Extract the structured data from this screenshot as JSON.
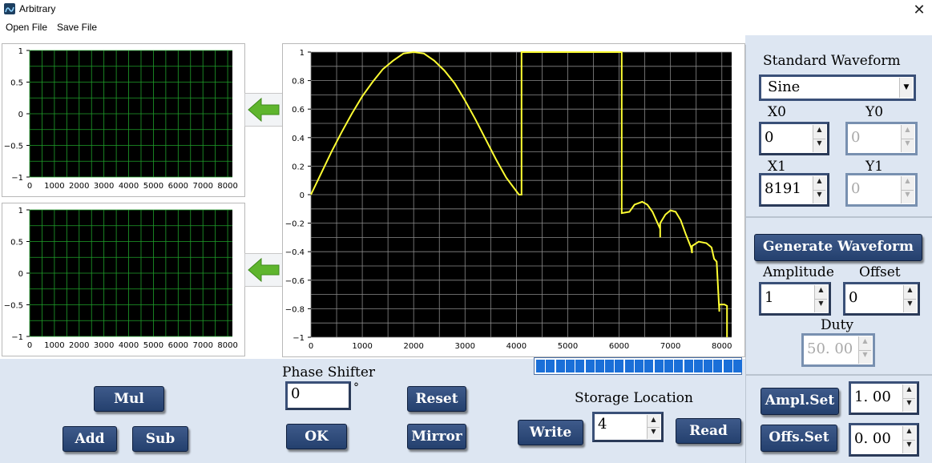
{
  "window": {
    "title": "Arbitrary",
    "close_glyph": "✕"
  },
  "menu": {
    "items": [
      "Open File",
      "Save File"
    ]
  },
  "small_chart_1": {
    "chart_data": {
      "type": "line",
      "xlim": [
        0,
        8191
      ],
      "ylim": [
        -1,
        1
      ],
      "xticks": [
        "0",
        "1000",
        "2000",
        "3000",
        "4000",
        "5000",
        "6000",
        "7000",
        "8000"
      ],
      "yticks": [
        "1",
        "0.5",
        "0",
        "−0.5",
        "−1"
      ],
      "series": [],
      "grid": true
    }
  },
  "small_chart_2": {
    "chart_data": {
      "type": "line",
      "xlim": [
        0,
        8191
      ],
      "ylim": [
        -1,
        1
      ],
      "xticks": [
        "0",
        "1000",
        "2000",
        "3000",
        "4000",
        "5000",
        "6000",
        "7000",
        "8000"
      ],
      "yticks": [
        "1",
        "0.5",
        "0",
        "−0.5",
        "−1"
      ],
      "series": [],
      "grid": true
    }
  },
  "main_chart": {
    "chart_data": {
      "type": "line",
      "xlim": [
        0,
        8191
      ],
      "ylim": [
        -1,
        1
      ],
      "xticks": [
        "0",
        "1000",
        "2000",
        "3000",
        "4000",
        "5000",
        "6000",
        "7000",
        "8000"
      ],
      "yticks": [
        "1",
        "0.8",
        "0.6",
        "0.4",
        "0.2",
        "0",
        "−0.2",
        "−0.4",
        "−0.6",
        "−0.8",
        "−1"
      ],
      "grid": true,
      "series": [
        {
          "color": "#ffff33",
          "points": [
            [
              0,
              0
            ],
            [
              200,
              0.15
            ],
            [
              400,
              0.3
            ],
            [
              600,
              0.44
            ],
            [
              800,
              0.57
            ],
            [
              1000,
              0.69
            ],
            [
              1200,
              0.79
            ],
            [
              1400,
              0.88
            ],
            [
              1600,
              0.94
            ],
            [
              1800,
              0.99
            ],
            [
              2000,
              1.0
            ],
            [
              2200,
              0.99
            ],
            [
              2400,
              0.94
            ],
            [
              2600,
              0.87
            ],
            [
              2800,
              0.78
            ],
            [
              3000,
              0.66
            ],
            [
              3200,
              0.53
            ],
            [
              3400,
              0.39
            ],
            [
              3600,
              0.25
            ],
            [
              3800,
              0.12
            ],
            [
              4050,
              0.0
            ],
            [
              4100,
              0.0
            ],
            [
              4100,
              1.0
            ],
            [
              6050,
              1.0
            ],
            [
              6050,
              -0.13
            ],
            [
              6200,
              -0.12
            ],
            [
              6300,
              -0.07
            ],
            [
              6450,
              -0.05
            ],
            [
              6550,
              -0.07
            ],
            [
              6650,
              -0.12
            ],
            [
              6700,
              -0.16
            ],
            [
              6750,
              -0.2
            ],
            [
              6800,
              -0.24
            ],
            [
              6800,
              -0.3
            ],
            [
              6800,
              -0.2
            ],
            [
              6900,
              -0.14
            ],
            [
              7000,
              -0.11
            ],
            [
              7100,
              -0.12
            ],
            [
              7200,
              -0.18
            ],
            [
              7300,
              -0.28
            ],
            [
              7400,
              -0.37
            ],
            [
              7420,
              -0.41
            ],
            [
              7420,
              -0.36
            ],
            [
              7550,
              -0.33
            ],
            [
              7700,
              -0.34
            ],
            [
              7800,
              -0.37
            ],
            [
              7850,
              -0.45
            ],
            [
              7900,
              -0.47
            ],
            [
              7950,
              -0.82
            ],
            [
              7950,
              -0.77
            ],
            [
              8050,
              -0.77
            ],
            [
              8100,
              -0.78
            ],
            [
              8100,
              -1.0
            ]
          ]
        }
      ]
    }
  },
  "phase_shifter": {
    "label": "Phase Shifter",
    "value": "0",
    "unit": "°",
    "ok_label": "OK"
  },
  "buttons": {
    "mul": "Mul",
    "add": "Add",
    "sub": "Sub",
    "reset": "Reset",
    "mirror": "Mirror",
    "write": "Write",
    "read": "Read"
  },
  "storage": {
    "label": "Storage Location",
    "value": "4"
  },
  "progress": {
    "segments": 21,
    "filled": 21
  },
  "standard": {
    "title": "Standard Waveform",
    "waveform": "Sine",
    "x0_label": "X0",
    "x0": "0",
    "y0_label": "Y0",
    "y0": "0",
    "x1_label": "X1",
    "x1": "8191",
    "y1_label": "Y1",
    "y1": "0"
  },
  "generate": {
    "button": "Generate Waveform",
    "amplitude_label": "Amplitude",
    "amplitude": "1",
    "offset_label": "Offset",
    "offset": "0",
    "duty_label": "Duty",
    "duty": "50. 00"
  },
  "settings": {
    "ampl_button": "Ampl.Set",
    "ampl_value": "1. 00",
    "offs_button": "Offs.Set",
    "offs_value": "0. 00"
  }
}
